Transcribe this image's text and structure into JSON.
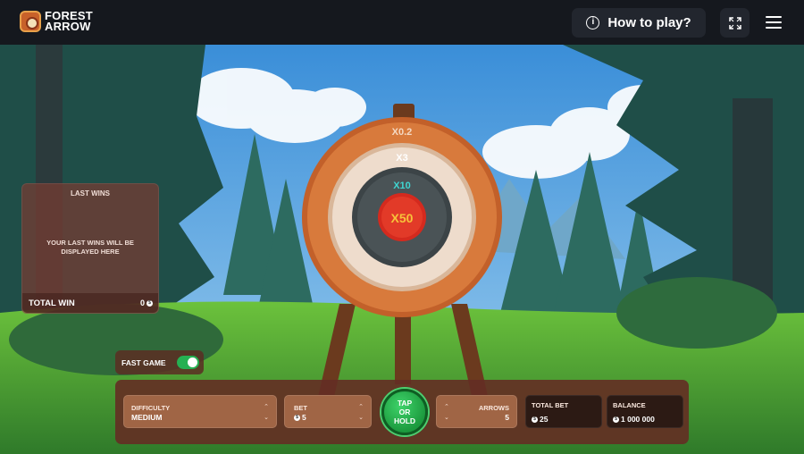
{
  "header": {
    "logo_line1": "FOREST",
    "logo_line2": "ARROW",
    "how_to_play": "How to play?"
  },
  "icons": {
    "info": "info-icon",
    "fullscreen": "fullscreen-icon",
    "menu": "hamburger-menu-icon",
    "coin": "coin-icon"
  },
  "target": {
    "outer_label": "X0.2",
    "ring2_label": "X3",
    "ring3_label": "X10",
    "center_label": "X50"
  },
  "last_wins": {
    "title": "LAST WINS",
    "empty_text": "YOUR LAST WINS WILL BE DISPLAYED HERE",
    "total_label": "TOTAL WIN",
    "total_value": "0"
  },
  "fast_game": {
    "label": "FAST GAME",
    "enabled": true
  },
  "controls": {
    "difficulty_label": "DIFFICULTY",
    "difficulty_value": "MEDIUM",
    "bet_label": "BET",
    "bet_value": "5",
    "tap_line1": "TAP",
    "tap_line2": "OR",
    "tap_line3": "HOLD",
    "arrows_label": "ARROWS",
    "arrows_value": "5",
    "total_bet_label": "TOTAL BET",
    "total_bet_value": "25",
    "balance_label": "BALANCE",
    "balance_value": "1 000 000"
  },
  "colors": {
    "accent_green": "#25b052",
    "center_red": "#d42a1e",
    "label_gold": "#f7c23a",
    "label_cyan": "#3fd6d2"
  }
}
